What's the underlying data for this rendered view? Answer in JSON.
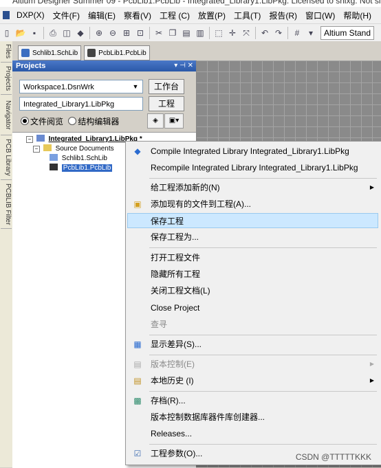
{
  "window": {
    "title": "Altium Designer Summer 09 - PcbLib1.PcbLib - Integrated_Library1.LibPkg. Licensed to shixg. Not signed in."
  },
  "menubar": {
    "items": [
      "DXP(X)",
      "文件(F)",
      "编辑(E)",
      "察看(V)",
      "工程 (C)",
      "放置(P)",
      "工具(T)",
      "报告(R)",
      "窗口(W)",
      "帮助(H)"
    ]
  },
  "toolbar": {
    "combo": "Altium Stand"
  },
  "left_tabs": [
    "Files",
    "Projects",
    "Navigator",
    "PCB Library",
    "PCBLIB Filter"
  ],
  "doc_tabs": [
    "Schlib1.SchLib",
    "PcbLib1.PcbLib"
  ],
  "panel": {
    "title": "Projects",
    "workspace": "Workspace1.DsnWrk",
    "workspace_btn": "工作台",
    "project": "Integrated_Library1.LibPkg",
    "project_btn": "工程",
    "radio_file_view": "文件阅览",
    "radio_struct_editor": "结构编辑器"
  },
  "tree": {
    "root": "Integrated_Library1.LibPkg *",
    "folder": "Source Documents",
    "files": [
      "Schlib1.SchLib",
      "PcbLib1.PcbLib"
    ]
  },
  "context_menu": {
    "compile": "Compile Integrated Library Integrated_Library1.LibPkg",
    "recompile": "Recompile Integrated Library Integrated_Library1.LibPkg",
    "add_new": "给工程添加新的(N)",
    "add_existing": "添加现有的文件到工程(A)...",
    "save_project": "保存工程",
    "save_project_as": "保存工程为...",
    "open_project_docs": "打开工程文件",
    "hide_all": "隐藏所有工程",
    "close_project_docs": "关闭工程文档(L)",
    "close_project": "Close Project",
    "find": "查寻",
    "show_diff": "显示差异(S)...",
    "version_control": "版本控制(E)",
    "local_history": "本地历史 (I)",
    "archive": "存档(R)...",
    "vc_db_lib_creator": "版本控制数据库器件库创建器...",
    "releases": "Releases...",
    "project_params": "工程参数(O)..."
  },
  "watermark": "CSDN @TTTTTKKK"
}
